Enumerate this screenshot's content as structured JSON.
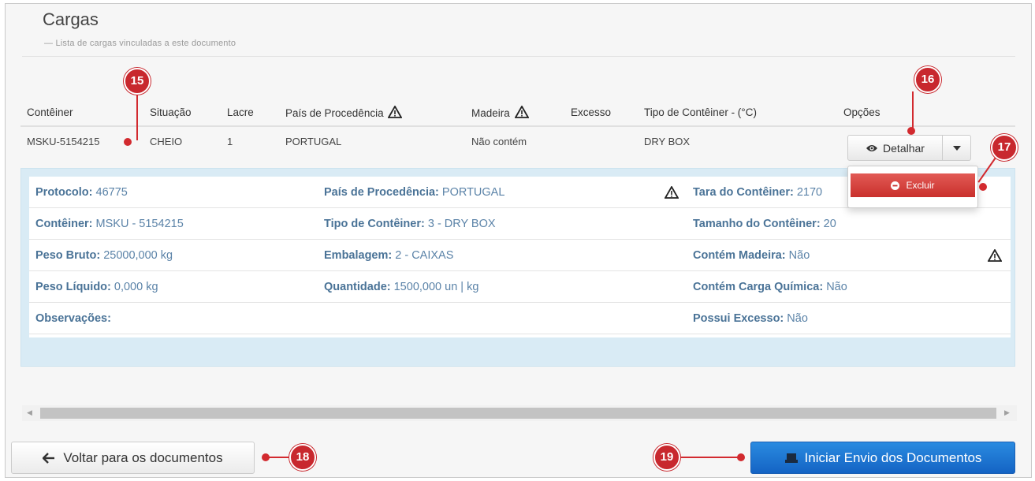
{
  "panel": {
    "title": "Cargas",
    "subtitle": "— Lista de cargas vinculadas a este documento"
  },
  "table": {
    "headers": [
      "Contêiner",
      "Situação",
      "Lacre",
      "País de Procedência",
      "Madeira",
      "Excesso",
      "Tipo de Contêiner - (°C)",
      "Opções"
    ],
    "row": {
      "container": "MSKU-5154215",
      "situacao": "CHEIO",
      "lacre": "1",
      "pais": "PORTUGAL",
      "madeira": "Não contém",
      "excesso": "",
      "tipo": "DRY BOX"
    }
  },
  "detail": {
    "rows": [
      [
        {
          "label": "Protocolo:",
          "value": " 46775"
        },
        {
          "label": "País de Procedência:",
          "value": " PORTUGAL"
        },
        {
          "label": "Tara do Contêiner:",
          "value": " 2170"
        }
      ],
      [
        {
          "label": "Contêiner:",
          "value": " MSKU - 5154215"
        },
        {
          "label": "Tipo de Contêiner:",
          "value": " 3 - DRY BOX"
        },
        {
          "label": "Tamanho do Contêiner:",
          "value": " 20"
        }
      ],
      [
        {
          "label": "Peso Bruto:",
          "value": " 25000,000 kg"
        },
        {
          "label": "Embalagem:",
          "value": " 2 - CAIXAS"
        },
        {
          "label": "Contém Madeira:",
          "value": " Não"
        }
      ],
      [
        {
          "label": "Peso Líquido:",
          "value": " 0,000 kg"
        },
        {
          "label": "Quantidade:",
          "value": " 1500,000 un | kg"
        },
        {
          "label": "Contém Carga Química:",
          "value": " Não"
        }
      ],
      [
        {
          "label": "Observações:",
          "value": ""
        },
        {
          "label": "",
          "value": ""
        },
        {
          "label": "Possui Excesso:",
          "value": " Não"
        }
      ]
    ]
  },
  "actions": {
    "detalhar": "Detalhar",
    "excluir": "Excluir",
    "back": "Voltar para os documentos",
    "send": "Iniciar Envio dos Documentos"
  },
  "callouts": [
    "15",
    "16",
    "17",
    "18",
    "19"
  ],
  "icons": {
    "warning": "warning-triangle-icon",
    "eye": "eye-icon",
    "caret": "caret-down-icon",
    "minus": "minus-circle-icon",
    "arrow_left": "arrow-left-icon",
    "send": "send-icon"
  },
  "colors": {
    "accent_red": "#c8282e",
    "primary_blue": "#1463c4",
    "label_blue": "#4a7397",
    "detail_bg": "#d9ebf5"
  }
}
